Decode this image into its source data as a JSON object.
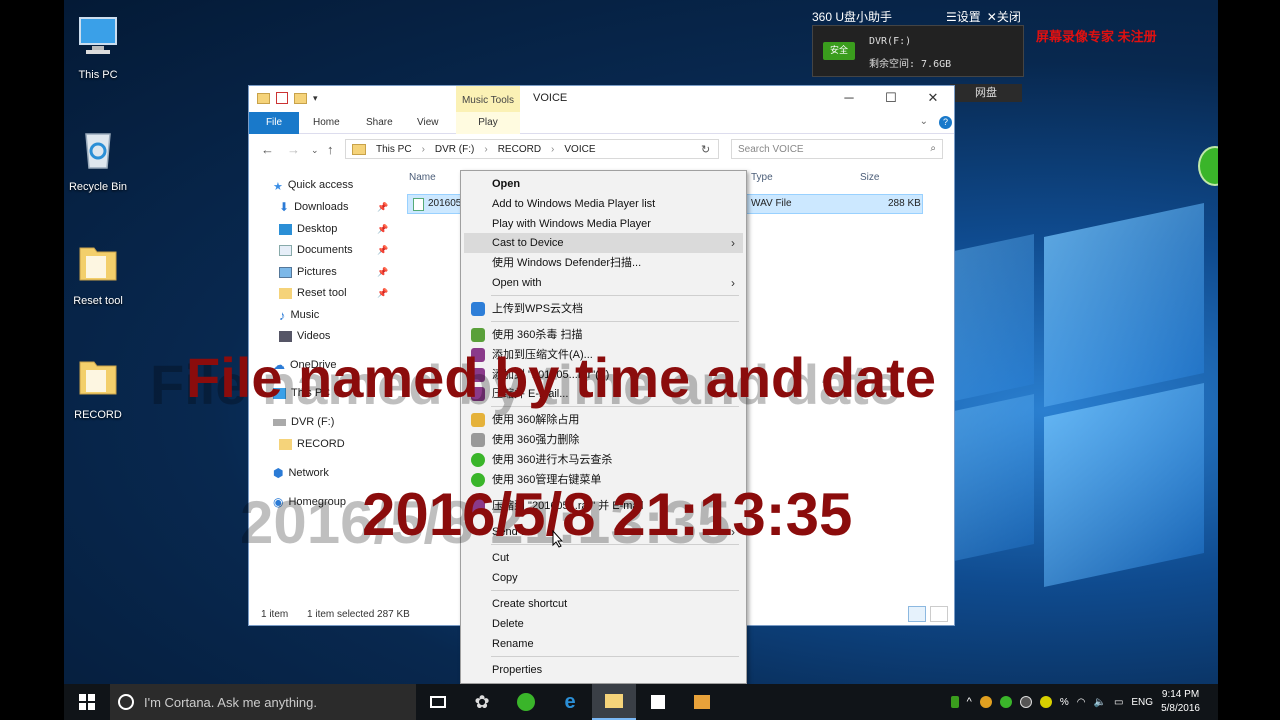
{
  "desktop_icons": [
    {
      "label": "This PC"
    },
    {
      "label": "Recycle Bin"
    },
    {
      "label": "Reset tool"
    },
    {
      "label": "RECORD"
    }
  ],
  "widget360": {
    "title": "360 U盘小助手",
    "settings": "☰设置",
    "close": "✕关闭",
    "safe_badge": "安全",
    "drive": "DVR(F:)",
    "free_space": "剩余空间: 7.6GB",
    "net_drive": "网盘"
  },
  "recorder_watermark": "屏幕录像专家  未注册",
  "explorer": {
    "music_tools": "Music Tools",
    "title": "VOICE",
    "tabs": {
      "file": "File",
      "home": "Home",
      "share": "Share",
      "view": "View",
      "play": "Play"
    },
    "breadcrumb": [
      "This PC",
      "DVR (F:)",
      "RECORD",
      "VOICE"
    ],
    "search_placeholder": "Search VOICE",
    "nav": {
      "quick_access": "Quick access",
      "downloads": "Downloads",
      "desktop": "Desktop",
      "documents": "Documents",
      "pictures": "Pictures",
      "reset_tool": "Reset tool",
      "music": "Music",
      "videos": "Videos",
      "onedrive": "OneDrive",
      "this_pc": "This PC",
      "dvr": "DVR (F:)",
      "record": "RECORD",
      "network": "Network",
      "homegroup": "Homegroup"
    },
    "columns": {
      "name": "Name",
      "type": "Type",
      "size": "Size"
    },
    "file": {
      "name": "201605",
      "type": "WAV File",
      "size": "288 KB"
    },
    "status_items": "1 item",
    "status_selected": "1 item selected  287 KB"
  },
  "context_menu": {
    "open": "Open",
    "add_wmp": "Add to Windows Media Player list",
    "play_wmp": "Play with Windows Media Player",
    "cast": "Cast to Device",
    "defender": "使用 Windows Defender扫描...",
    "open_with": "Open with",
    "wps": "上传到WPS云文档",
    "scan360": "使用 360杀毒 扫描",
    "add_archive": "添加到压缩文件(A)...",
    "compress_rar": "添加到 \"201605...rar\"(T)",
    "compress_email": "压缩并 E-mail...",
    "unlock360": "使用 360解除占用",
    "delete360": "使用 360强力删除",
    "trojan360": "使用 360进行木马云查杀",
    "manage360": "使用 360管理右键菜单",
    "compress_rar_email": "压缩到 \"201605...rar\" 并 E-mail",
    "send_to": "Send to",
    "cut": "Cut",
    "copy": "Copy",
    "create_shortcut": "Create shortcut",
    "delete": "Delete",
    "rename": "Rename",
    "properties": "Properties"
  },
  "captions": {
    "line1": "File named by time and date",
    "line2": "2016/5/8  21:13:35"
  },
  "taskbar": {
    "cortana": "I'm Cortana. Ask me anything.",
    "lang": "ENG",
    "time": "9:14 PM",
    "date": "5/8/2016"
  },
  "colors": {
    "caption": "#8b0c0c",
    "accent": "#1979ca",
    "selection": "#cce8ff"
  }
}
